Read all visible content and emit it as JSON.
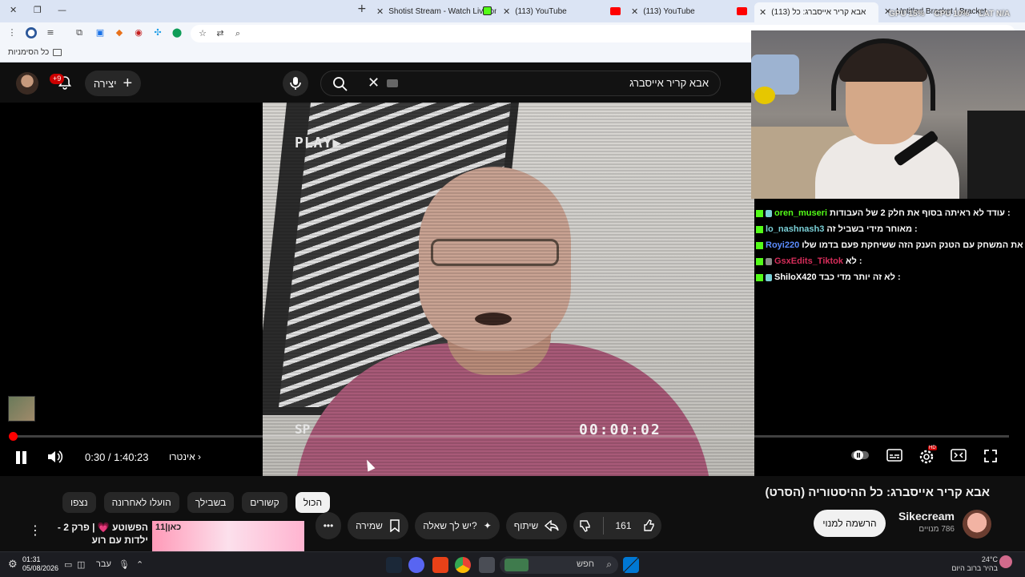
{
  "browser": {
    "tabs": [
      {
        "title": "Shotist Stream - Watch Live on",
        "favicon": "kick"
      },
      {
        "title": "(113) YouTube",
        "favicon": "youtube"
      },
      {
        "title": "(113) YouTube",
        "favicon": "youtube"
      },
      {
        "title": "אבא קריר אייסברג: כל (113)",
        "favicon": "youtube"
      },
      {
        "title": "Untitled Bracket | Bracket HQ",
        "favicon": "bracket"
      }
    ],
    "overlay_stats": {
      "gpu": "GPU 15%",
      "cpu": "CPU 10%",
      "lat": "LAT N/A"
    },
    "bookmarks_label": "כל הסימניות"
  },
  "youtube": {
    "notifications_badge": "+9",
    "create_label": "יצירה",
    "search_query": "אבא קריר אייסברג",
    "player": {
      "overlay_play": "PLAY▶",
      "overlay_sp": "SP",
      "overlay_timecode": "00:00:02",
      "current_time": "0:30 / 1:40:23",
      "chapter": "אינטרו",
      "progress": 0.005
    },
    "filter_chips": [
      "נצפו",
      "הועלו לאחרונה",
      "בשבילך",
      "קשורים",
      "הכול"
    ],
    "active_chip": "הכול",
    "recommendation": {
      "title": "הפשוטע 💗 | פרק 2 - ילדות עם רוע",
      "thumb_text": "כאן|11"
    },
    "video": {
      "title": "אבא קריר אייסברג: כל ההיסטוריה (הסרט)",
      "channel": "Sikecream",
      "subscribers": "786 מנויים",
      "subscribe_label": "הרשמה למנוי",
      "likes": "161",
      "share_label": "שיתוף",
      "ask_label": "יש לך שאלה?",
      "save_label": "שמירה"
    }
  },
  "stream_chat": [
    {
      "user": "oren_museri",
      "message": ": עודד לא ראיתה בסוף את חלק 2 של העבודות",
      "color": "#53fc18",
      "sub": true
    },
    {
      "user": "lo_nashnash3",
      "message": ": מאוחר מידי בשביל זה",
      "color": "#7ad0d7",
      "sub": false
    },
    {
      "user": "Royi220",
      "message": ": שחקו את המשחק עם הטנק הענק הזה ששיחקת פעם בדמו שלו",
      "color": "#5b8cff",
      "sub": false
    },
    {
      "user": "GsxEdits_Tiktok",
      "message": ": לא",
      "color": "#d62d5a",
      "sub": false
    },
    {
      "user": "ShiloX420",
      "message": ": לא זה יותר מדי כבד",
      "color": "#ffffff",
      "sub": true
    }
  ],
  "taskbar": {
    "time": "01:31",
    "date": "05/08/2026",
    "language": "עבר",
    "search_label": "חפש",
    "weather_temp": "24°C",
    "weather_desc": "בהיר ברוב היום"
  }
}
